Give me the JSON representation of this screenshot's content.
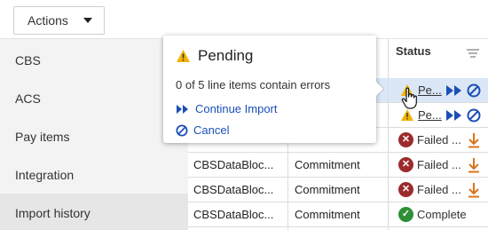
{
  "toolbar": {
    "actions_label": "Actions"
  },
  "sidebar": {
    "items": [
      {
        "label": "CBS",
        "active": false
      },
      {
        "label": "ACS",
        "active": false
      },
      {
        "label": "Pay items",
        "active": false
      },
      {
        "label": "Integration",
        "active": false
      },
      {
        "label": "Import history",
        "active": true
      }
    ]
  },
  "table": {
    "status_header": "Status",
    "rows": [
      {
        "file": "",
        "type": "",
        "status": "Pe...",
        "status_kind": "pending",
        "highlight": true
      },
      {
        "file": "",
        "type": "",
        "status": "Pe...",
        "status_kind": "pending",
        "highlight": false
      },
      {
        "file": "",
        "type": "",
        "status": "Failed ...",
        "status_kind": "failed",
        "highlight": false
      },
      {
        "file": "CBSDataBloc...",
        "type": "Commitment",
        "status": "Failed ...",
        "status_kind": "failed",
        "highlight": false
      },
      {
        "file": "CBSDataBloc...",
        "type": "Commitment",
        "status": "Failed ...",
        "status_kind": "failed",
        "highlight": false
      },
      {
        "file": "CBSDataBloc...",
        "type": "Commitment",
        "status": "Complete",
        "status_kind": "complete",
        "highlight": false
      }
    ]
  },
  "popover": {
    "title": "Pending",
    "message": "0 of 5 line items contain errors",
    "continue_label": "Continue Import",
    "cancel_label": "Cancel"
  },
  "colors": {
    "warning": "#f2b400",
    "link": "#1b4fb6",
    "error": "#9c2b2b",
    "success": "#2f8f36",
    "download": "#d9741a",
    "row_highlight": "#dbe7f7"
  }
}
